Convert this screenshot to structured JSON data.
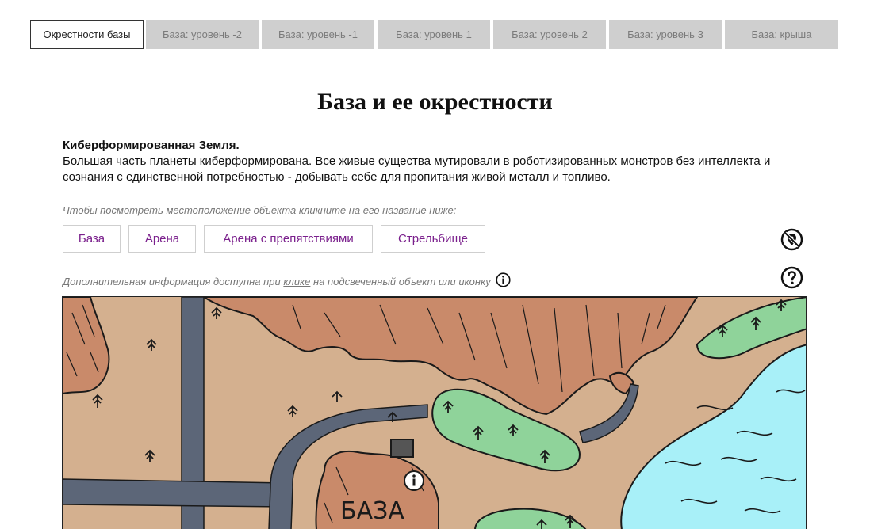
{
  "tabs": [
    {
      "label": "Окрестности базы",
      "active": true
    },
    {
      "label": "База: уровень -2",
      "active": false
    },
    {
      "label": "База: уровень -1",
      "active": false
    },
    {
      "label": "База: уровень 1",
      "active": false
    },
    {
      "label": "База: уровень 2",
      "active": false
    },
    {
      "label": "База: уровень 3",
      "active": false
    },
    {
      "label": "База: крыша",
      "active": false
    }
  ],
  "page_title": "База и ее окрестности",
  "intro": {
    "heading": "Киберформированная Земля.",
    "text": "Большая часть планеты киберформирована. Все живые существа мутировали в роботизированных монстров без интеллекта и сознания с единственной потребностью - добывать себе для пропитания живой металл и топливо."
  },
  "hint_locate": {
    "before": "Чтобы посмотреть местоположение объекта ",
    "link": "кликните",
    "after": " на его название ниже:"
  },
  "objects": [
    {
      "label": "База"
    },
    {
      "label": "Арена"
    },
    {
      "label": "Арена с препятствиями"
    },
    {
      "label": "Стрельбище"
    }
  ],
  "hint_info": {
    "before": "Дополнительная информация доступна при ",
    "link": "клике",
    "after": " на подсвеченный объект или иконку"
  },
  "map": {
    "base_label": "БАЗА",
    "colors": {
      "ground": "#d4b08f",
      "mountain": "#c98a6a",
      "forest": "#8fd39a",
      "water": "#a8f0f8",
      "road": "#5c6678",
      "outline": "#1a1a1a"
    }
  },
  "icons": {
    "close_map": "no-location-icon",
    "help": "help-icon",
    "info": "info-icon"
  }
}
